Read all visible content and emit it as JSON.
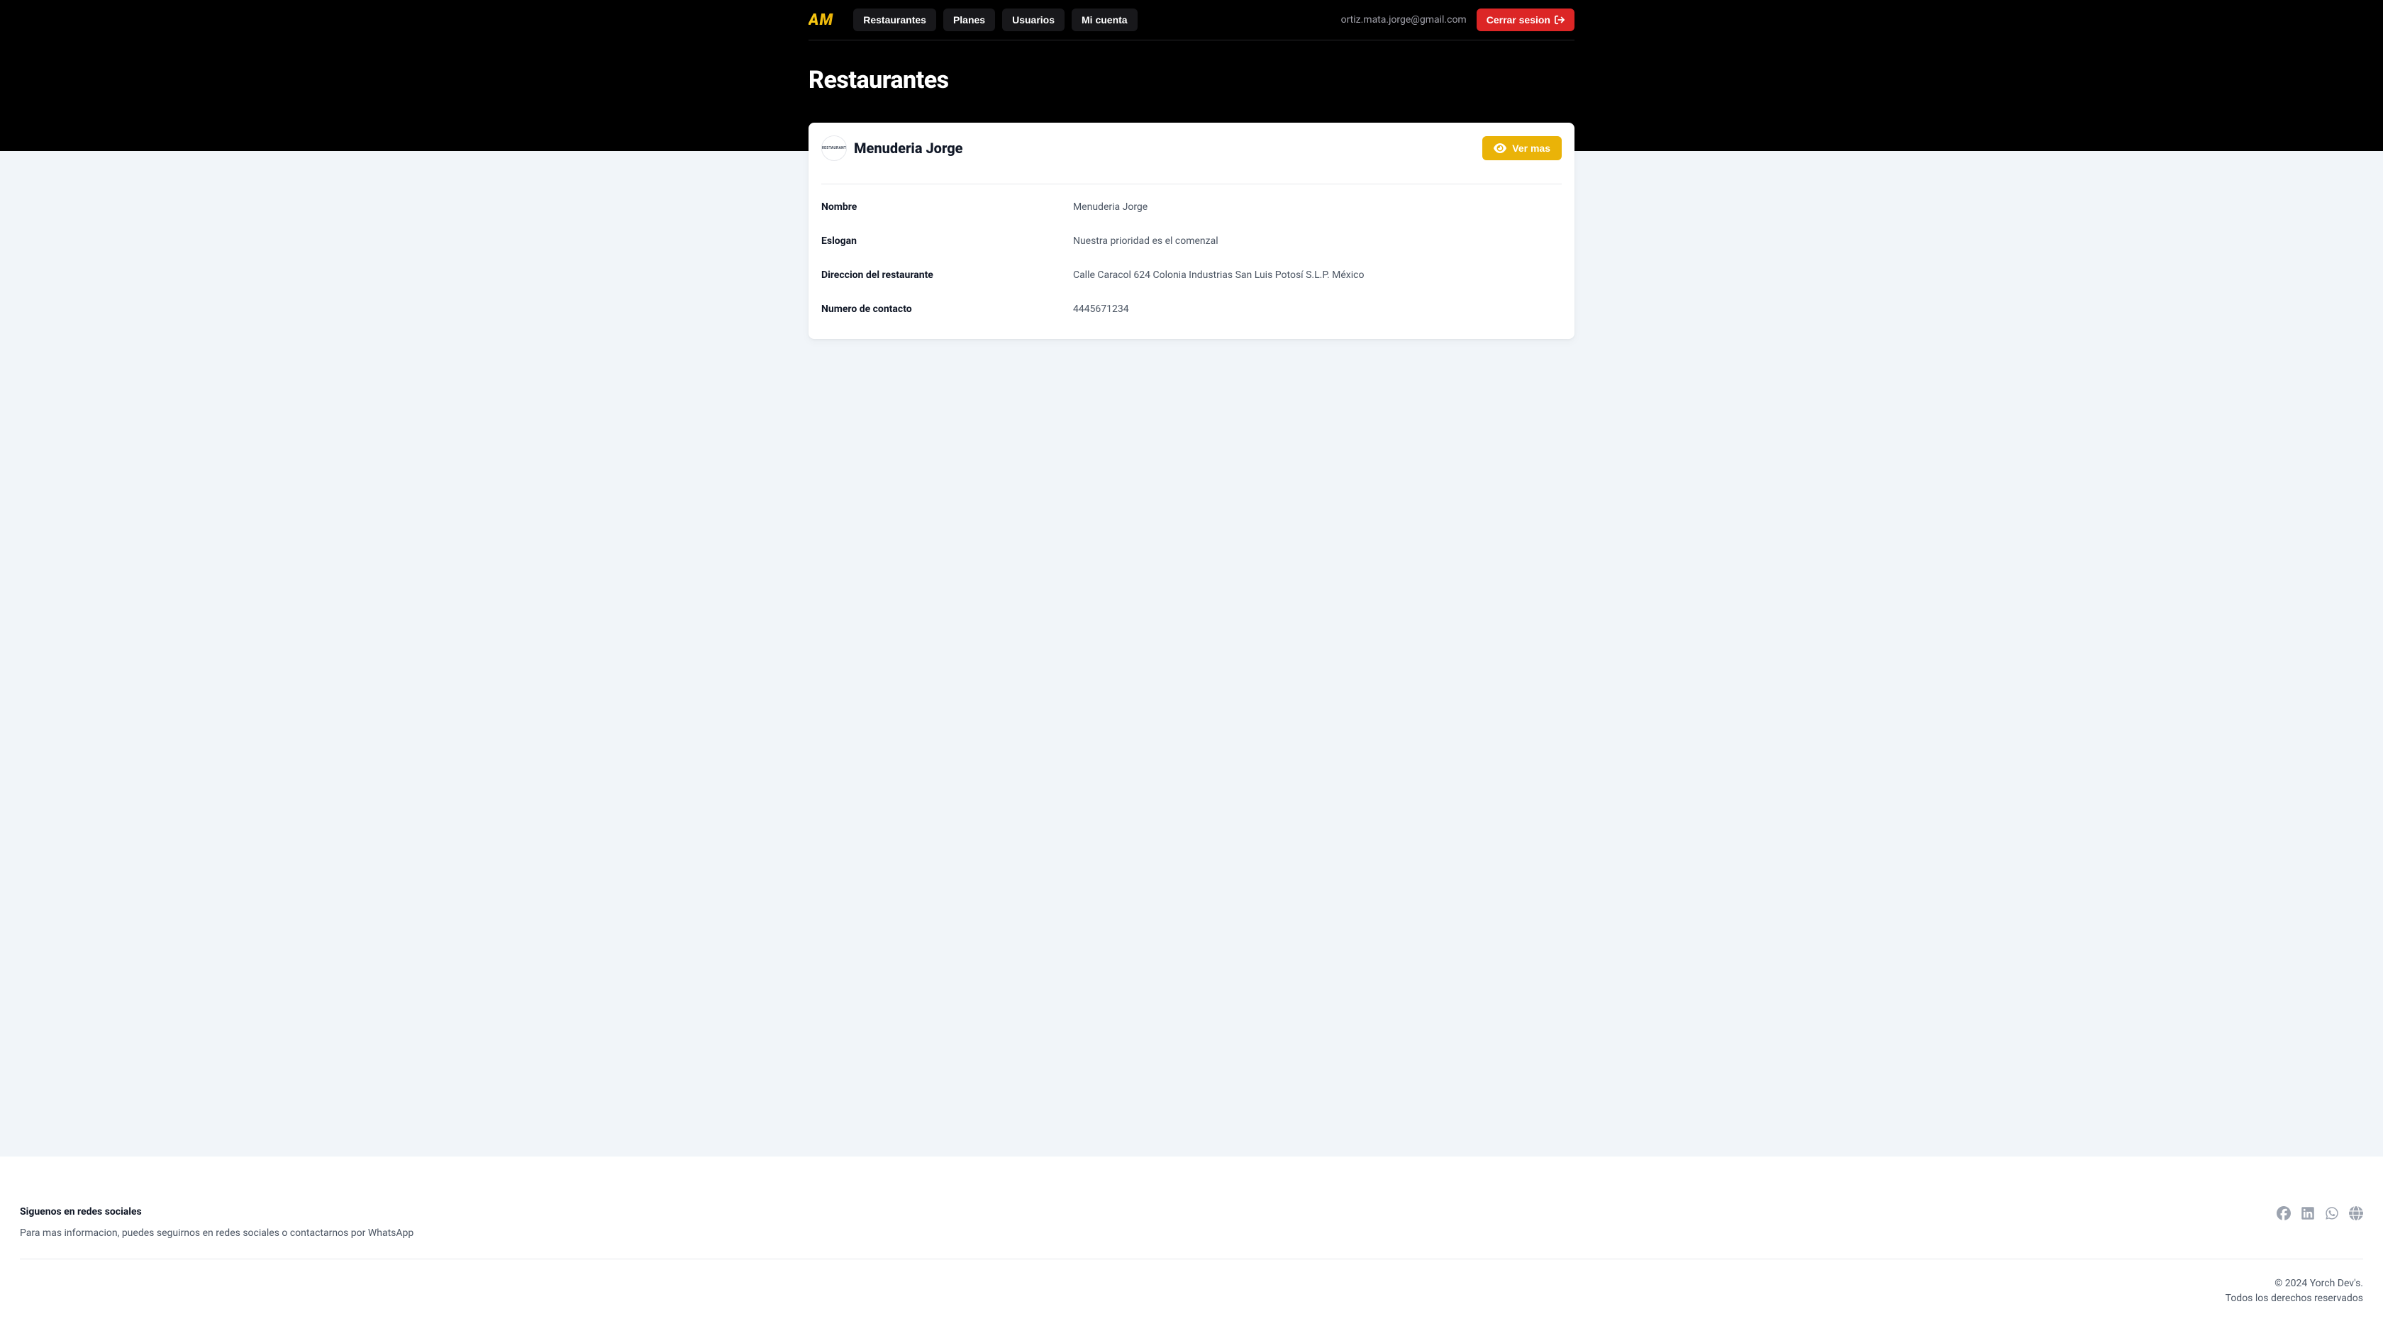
{
  "brand_logo_text": "AM",
  "nav": {
    "items": [
      {
        "label": "Restaurantes"
      },
      {
        "label": "Planes"
      },
      {
        "label": "Usuarios"
      },
      {
        "label": "Mi cuenta"
      }
    ],
    "user_email": "ortiz.mata.jorge@gmail.com",
    "logout_label": "Cerrar sesion"
  },
  "page_title": "Restaurantes",
  "restaurant": {
    "logo_text": "RESTAURANT",
    "display_name": "Menuderia Jorge",
    "view_more_label": "Ver mas",
    "fields": [
      {
        "label": "Nombre",
        "value": "Menuderia Jorge"
      },
      {
        "label": "Eslogan",
        "value": "Nuestra prioridad es el comenzal"
      },
      {
        "label": "Direccion del restaurante",
        "value": "Calle Caracol 624 Colonia Industrias San Luis Potosí S.L.P. México"
      },
      {
        "label": "Numero de contacto",
        "value": "4445671234"
      }
    ]
  },
  "footer": {
    "heading": "Siguenos en redes sociales",
    "text": "Para mas informacion, puedes seguirnos en redes sociales o contactarnos por WhatsApp",
    "copyright": "© 2024 Yorch Dev's.",
    "rights": "Todos los derechos reservados"
  }
}
